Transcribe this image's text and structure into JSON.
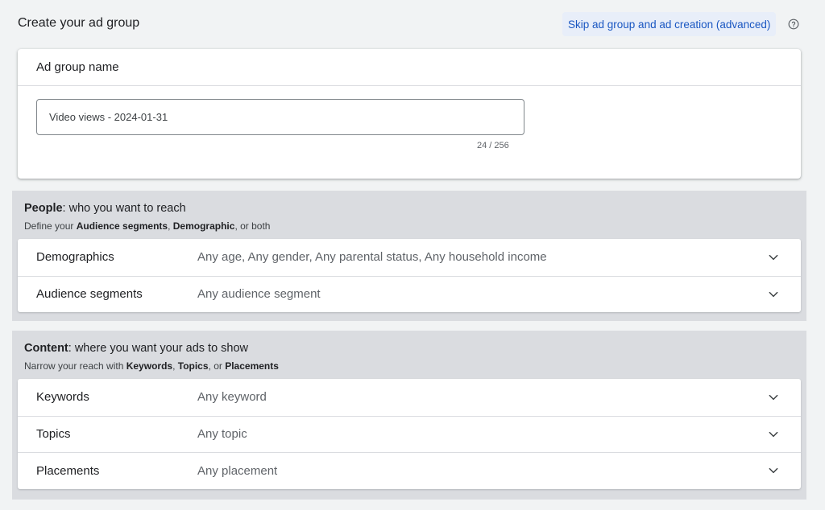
{
  "header": {
    "title": "Create your ad group",
    "skip_link": "Skip ad group and ad creation (advanced)"
  },
  "ad_group": {
    "label": "Ad group name",
    "value": "Video views - 2024-01-31",
    "char_count": "24 / 256"
  },
  "people": {
    "heading_bold": "People",
    "heading_rest": ": who you want to reach",
    "sub_prefix": "Define your ",
    "sub_b1": "Audience segments",
    "sub_mid": ", ",
    "sub_b2": "Demographic",
    "sub_suffix": ", or both",
    "rows": [
      {
        "label": "Demographics",
        "value": "Any age, Any gender, Any parental status, Any household income"
      },
      {
        "label": "Audience segments",
        "value": "Any audience segment"
      }
    ]
  },
  "content": {
    "heading_bold": "Content",
    "heading_rest": ": where you want your ads to show",
    "sub_prefix": "Narrow your reach with ",
    "sub_b1": "Keywords",
    "sub_mid1": ", ",
    "sub_b2": "Topics",
    "sub_mid2": ", or ",
    "sub_b3": "Placements",
    "rows": [
      {
        "label": "Keywords",
        "value": "Any keyword"
      },
      {
        "label": "Topics",
        "value": "Any topic"
      },
      {
        "label": "Placements",
        "value": "Any placement"
      }
    ]
  },
  "icons": {
    "help": "help-circle-icon",
    "expand": "chevron-down-icon"
  },
  "colors": {
    "link": "#1a57c2",
    "link_bg": "#e8eef9",
    "section_bg": "#dadce0",
    "page_bg": "#f1f3f4"
  }
}
